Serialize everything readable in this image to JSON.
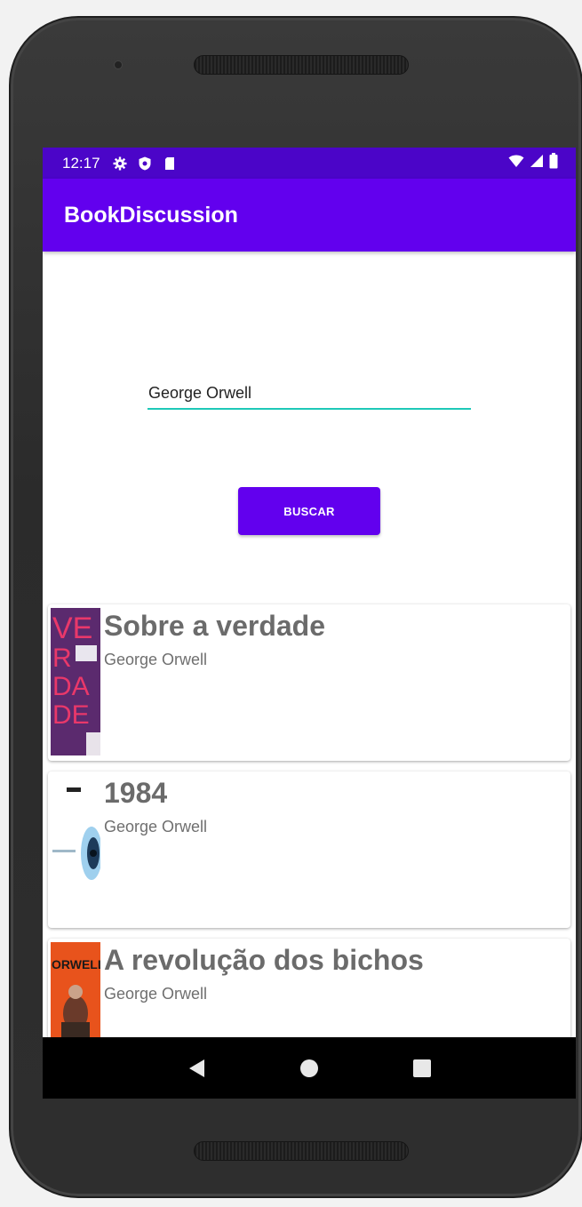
{
  "status_bar": {
    "time": "12:17",
    "left_icons": [
      "settings-icon",
      "shield-icon",
      "sd-card-icon"
    ],
    "right_icons": [
      "wifi-icon",
      "signal-icon",
      "battery-icon"
    ]
  },
  "app_bar": {
    "title": "BookDiscussion"
  },
  "search": {
    "value": "George Orwell"
  },
  "search_button": {
    "label": "BUSCAR"
  },
  "books": [
    {
      "title": "Sobre a verdade",
      "author": "George Orwell",
      "cover": "sobre-a-verdade-cover"
    },
    {
      "title": "1984",
      "author": "George Orwell",
      "cover": "1984-cover"
    },
    {
      "title": "A revolução dos bichos",
      "author": "George Orwell",
      "cover": "revolucao-dos-bichos-cover"
    }
  ],
  "colors": {
    "primary": "#6200ee",
    "status_bar": "#4b05c8",
    "input_underline": "#1ec9b8",
    "title_text": "#6b6b6b"
  },
  "nav": {
    "buttons": [
      "back-icon",
      "home-icon",
      "recents-icon"
    ]
  }
}
